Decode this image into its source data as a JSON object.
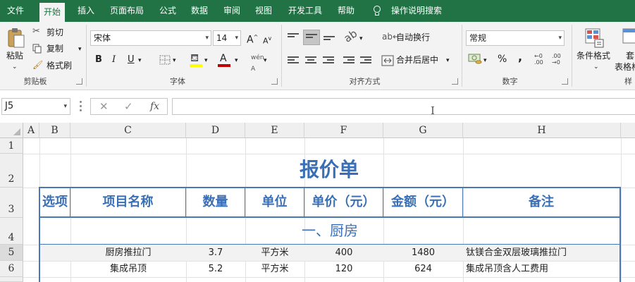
{
  "ribbon_tabs": [
    "文件",
    "开始",
    "插入",
    "页面布局",
    "公式",
    "数据",
    "审阅",
    "视图",
    "开发工具",
    "帮助"
  ],
  "tell_me": "操作说明搜索",
  "clipboard": {
    "paste": "粘贴",
    "cut": "剪切",
    "copy": "复制",
    "format_painter": "格式刷",
    "group": "剪贴板"
  },
  "font": {
    "name": "宋体",
    "size": "14",
    "bold": "B",
    "italic": "I",
    "underline": "U",
    "grow": "A",
    "shrink": "A",
    "font_color_letter": "A",
    "group": "字体"
  },
  "alignment": {
    "wrap": "自动换行",
    "merge": "合并后居中",
    "group": "对齐方式"
  },
  "number": {
    "format": "常规",
    "percent": "%",
    "comma": ",",
    "group": "数字"
  },
  "styles": {
    "conditional": "条件格式",
    "table_format_1": "套",
    "table_format_2": "表格格",
    "group_partial": "样"
  },
  "colors": {
    "ribbon_green": "#217346",
    "title_blue": "#3b6fb5",
    "border_blue": "#4a78b5",
    "font_color_red": "#c00000",
    "highlight_yellow": "#ffff00"
  },
  "formula_bar": {
    "name_box": "J5",
    "cancel": "✕",
    "enter": "✓",
    "fx": "fx",
    "formula": ""
  },
  "columns": [
    "A",
    "B",
    "C",
    "D",
    "E",
    "F",
    "G",
    "H"
  ],
  "rows": [
    "1",
    "2",
    "3",
    "4",
    "5",
    "6"
  ],
  "sheet": {
    "title": "报价单",
    "headers": [
      "选项",
      "项目名称",
      "数量",
      "单位",
      "单价（元）",
      "金额（元）",
      "备注"
    ],
    "section": "一、厨房",
    "data_rows": [
      [
        "",
        "厨房推拉门",
        "3.7",
        "平方米",
        "400",
        "1480",
        "钛镁合金双层玻璃推拉门"
      ],
      [
        "",
        "集成吊顶",
        "5.2",
        "平方米",
        "120",
        "624",
        "集成吊顶含人工费用"
      ]
    ]
  }
}
